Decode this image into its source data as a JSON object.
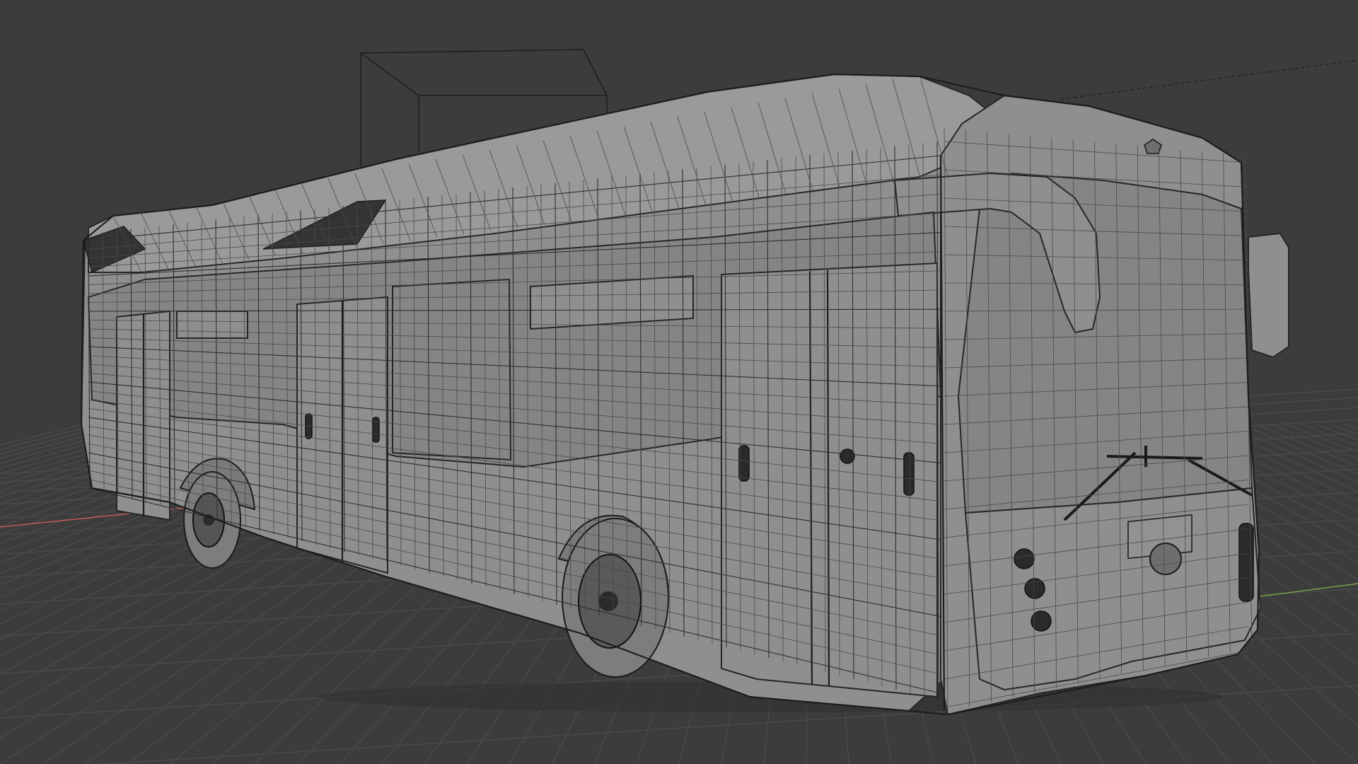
{
  "viewport": {
    "background_color": "#3c3c3c",
    "grid_color": "#4a4a4a",
    "mesh_fill_color": "#8f8f8f",
    "wire_color": "#2e2e2e",
    "x_axis_color": "#c05a5a",
    "y_axis_color": "#7fa84a",
    "shading_mode": "solid-wireframe",
    "object": "city-bus"
  }
}
